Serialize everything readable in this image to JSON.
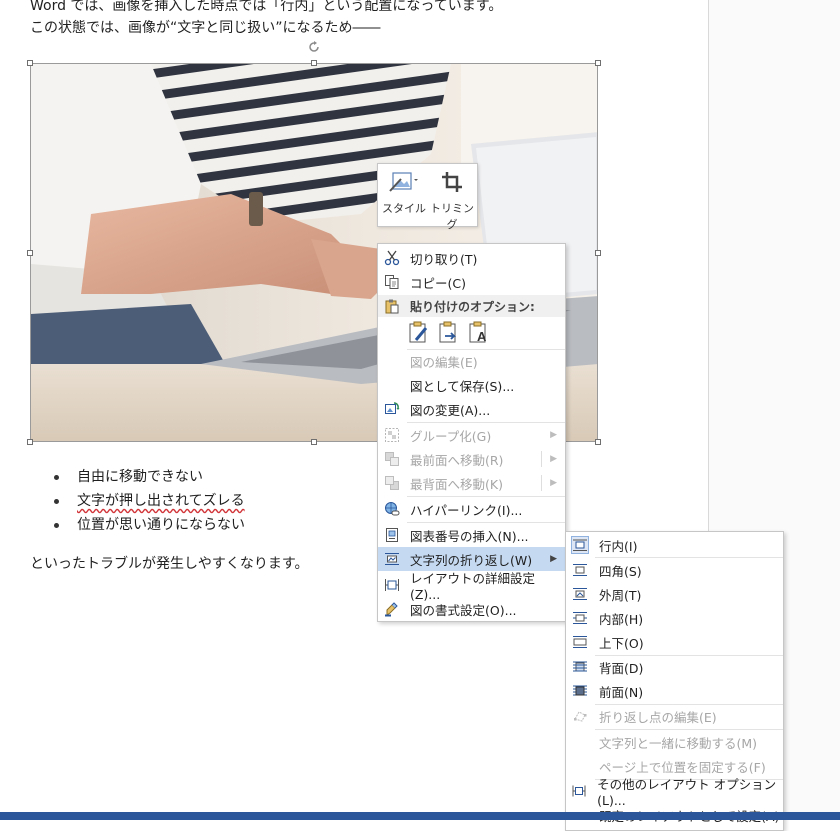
{
  "document": {
    "line1": "Word では、画像を挿入した時点では「行内」という配置になっています。",
    "line2": "この状態では、画像が“文字と同じ扱い”になるため――",
    "bullets": [
      "自由に移動できない",
      "文字が押し出されてズレる",
      "位置が思い通りにならない"
    ],
    "closing": "といったトラブルが発生しやすくなります。"
  },
  "mini_toolbar": {
    "style_label": "スタイル",
    "trim_label": "トリミング"
  },
  "context_menu": {
    "cut": "切り取り(T)",
    "copy": "コピー(C)",
    "paste_options": "貼り付けのオプション:",
    "edit_picture": "図の編集(E)",
    "save_as_picture": "図として保存(S)...",
    "change_picture": "図の変更(A)...",
    "group": "グループ化(G)",
    "bring_to_front": "最前面へ移動(R)",
    "send_to_back": "最背面へ移動(K)",
    "hyperlink": "ハイパーリンク(I)...",
    "insert_caption": "図表番号の挿入(N)...",
    "wrap_text": "文字列の折り返し(W)",
    "layout_settings": "レイアウトの詳細設定(Z)...",
    "format_picture": "図の書式設定(O)..."
  },
  "wrap_submenu": {
    "inline": "行内(I)",
    "square": "四角(S)",
    "tight": "外周(T)",
    "through": "内部(H)",
    "top_bottom": "上下(O)",
    "behind": "背面(D)",
    "in_front": "前面(N)",
    "edit_wrap_points": "折り返し点の編集(E)",
    "move_with_text": "文字列と一緒に移動する(M)",
    "fix_position": "ページ上で位置を固定する(F)",
    "more_layout": "その他のレイアウト オプション(L)...",
    "set_default": "既定のレイアウトとして設定(A)"
  },
  "colors": {
    "accent": "#2b579a",
    "hover": "#c5d9f1",
    "disabled": "#a6a6a6"
  }
}
